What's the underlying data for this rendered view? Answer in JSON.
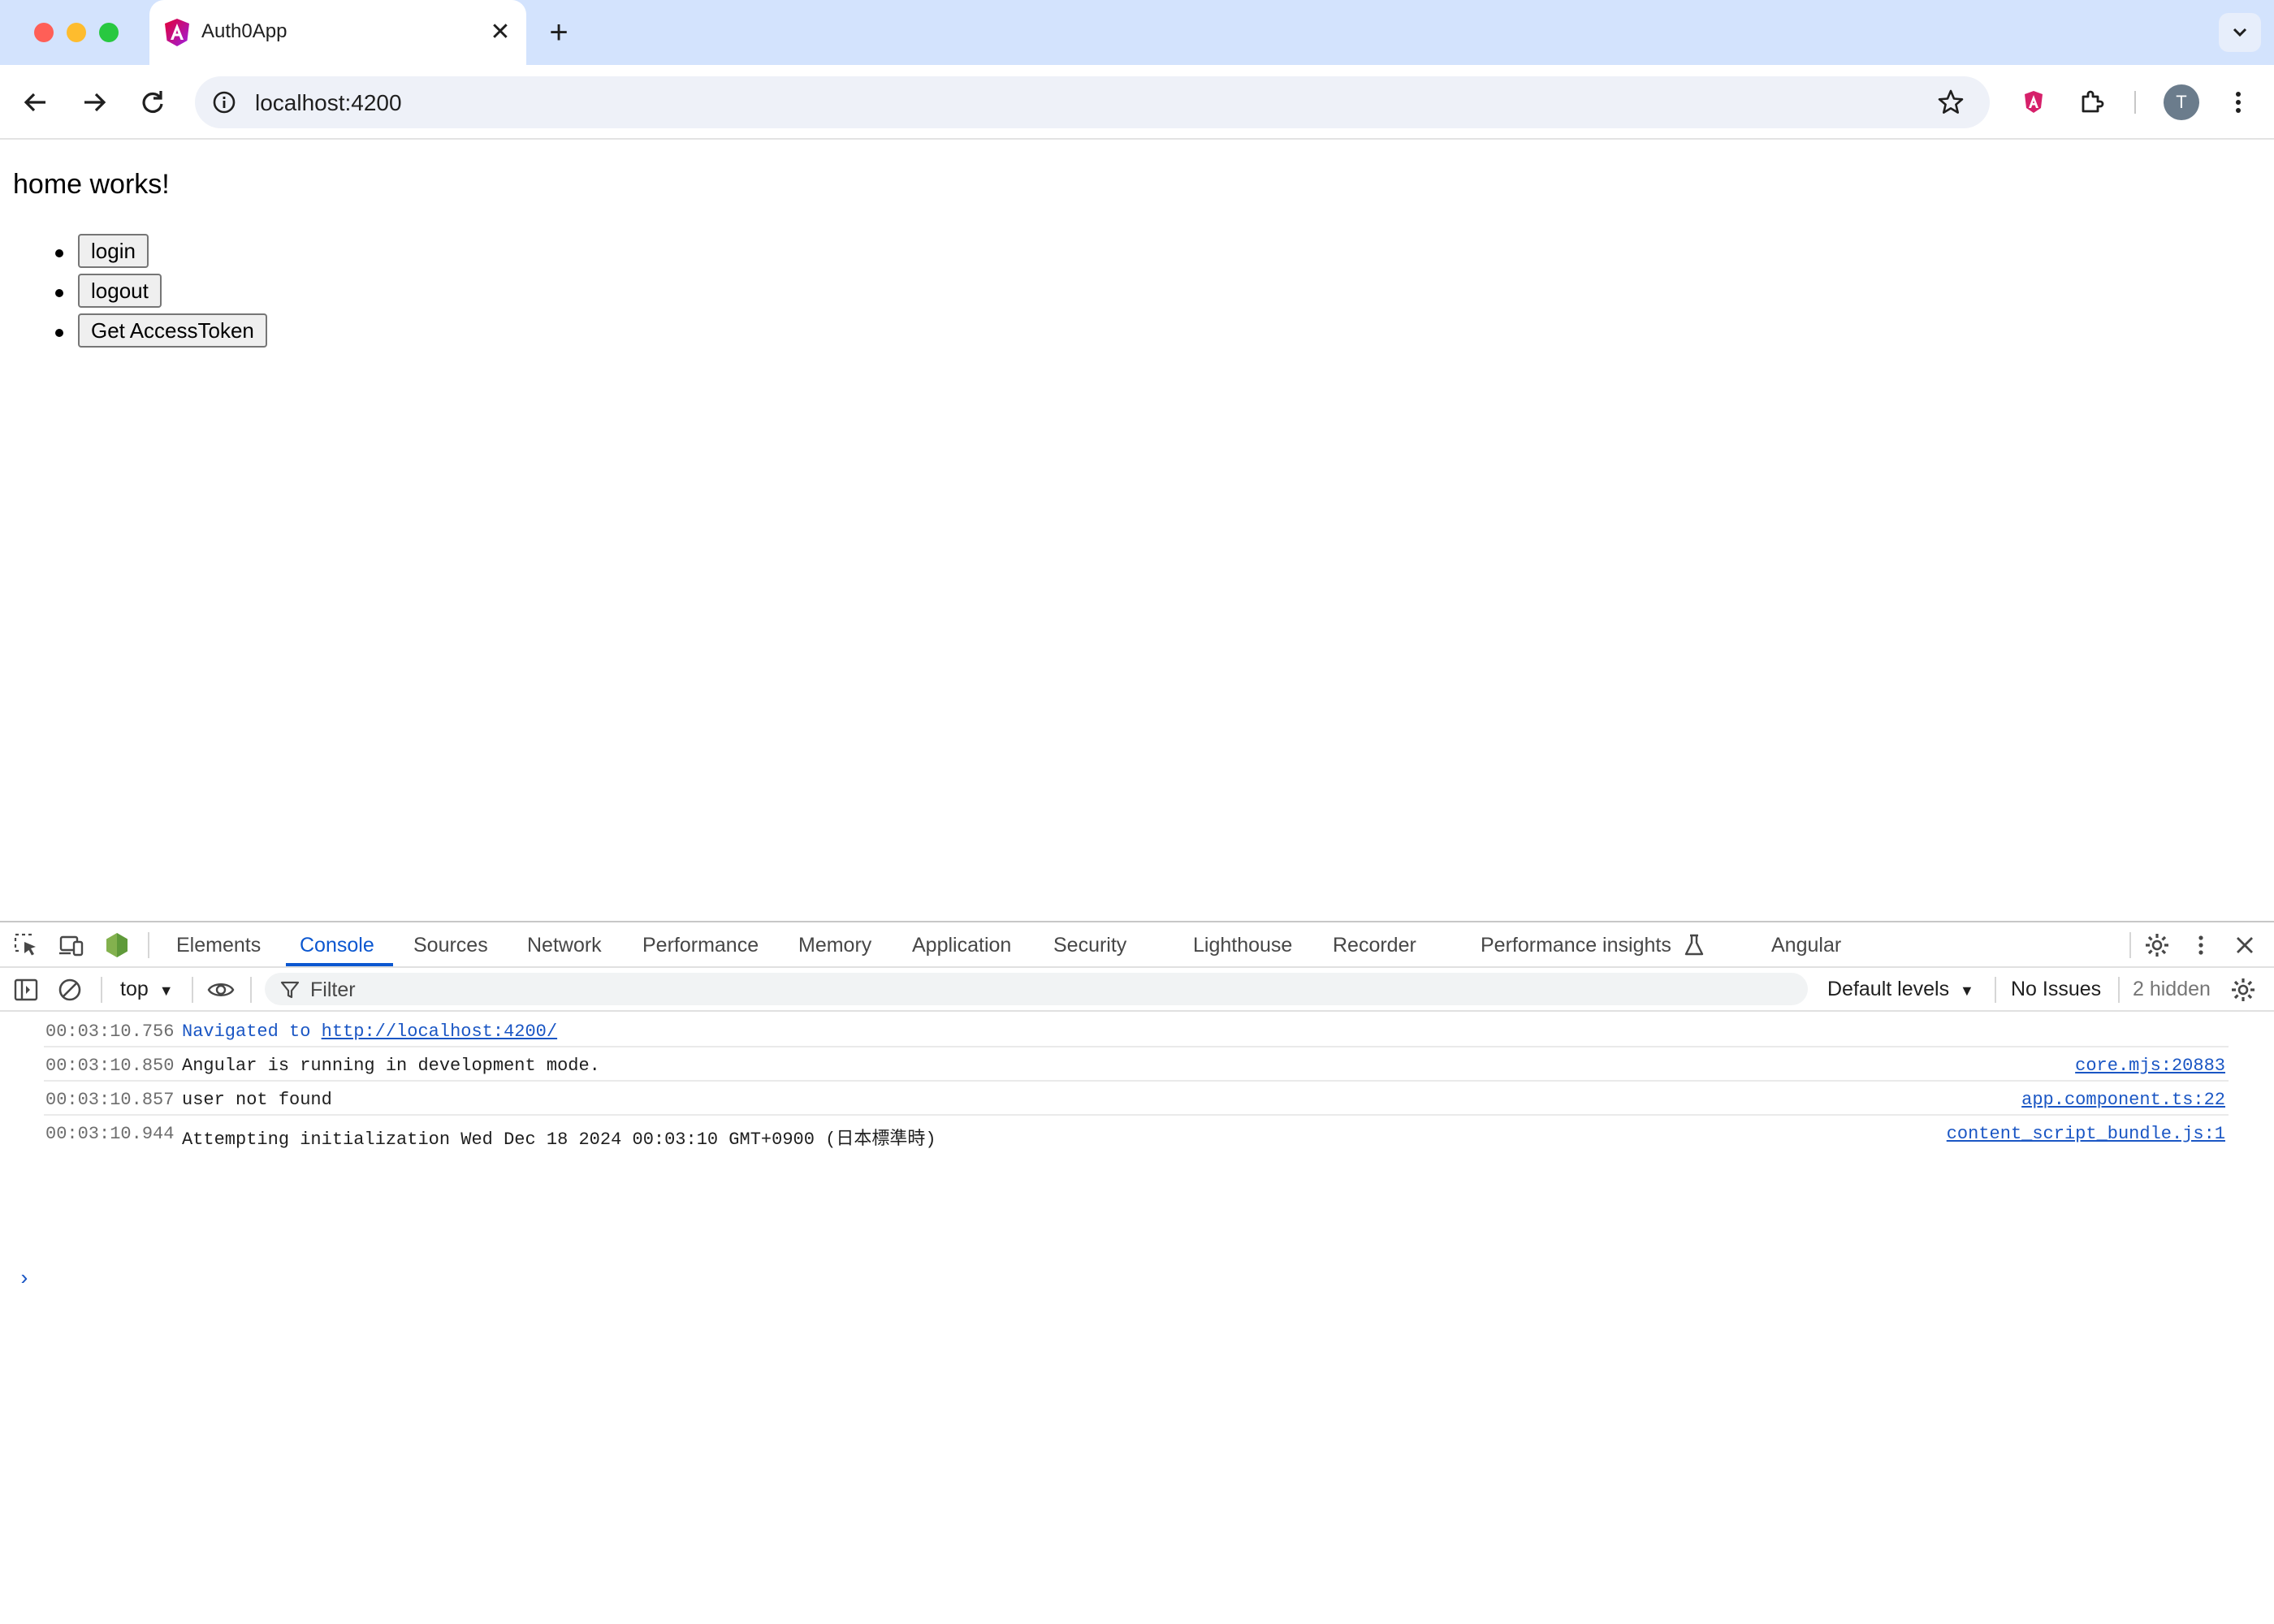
{
  "browser": {
    "tab": {
      "title": "Auth0App"
    },
    "new_tab_symbol": "+",
    "address": {
      "url": "localhost:4200"
    },
    "profile_initial": "T"
  },
  "page": {
    "heading": "home works!",
    "buttons": [
      "login",
      "logout",
      "Get AccessToken"
    ]
  },
  "devtools": {
    "tabs": [
      "Elements",
      "Console",
      "Sources",
      "Network",
      "Performance",
      "Memory",
      "Application",
      "Security",
      "Lighthouse",
      "Recorder",
      "Performance insights",
      "Angular"
    ],
    "active_tab": "Console",
    "context": "top",
    "filter_placeholder": "Filter",
    "levels": "Default levels",
    "issues": "No Issues",
    "hidden": "2 hidden",
    "console_rows": [
      {
        "time": "00:03:10.756",
        "text": "Navigated to ",
        "link": "http://localhost:4200/",
        "source": ""
      },
      {
        "time": "00:03:10.850",
        "text": "Angular is running in development mode.",
        "link": "",
        "source": "core.mjs:20883"
      },
      {
        "time": "00:03:10.857",
        "text": "user not found",
        "link": "",
        "source": "app.component.ts:22"
      },
      {
        "time": "00:03:10.944",
        "text": "Attempting initialization Wed Dec 18 2024 00:03:10 GMT+0900 (日本標準時)",
        "link": "",
        "source": "content_script_bundle.js:1"
      }
    ],
    "prompt_symbol": "›"
  },
  "colors": {
    "accent": "#0b57d0",
    "tabstrip": "#d3e3fd",
    "link": "#1a56c4"
  }
}
